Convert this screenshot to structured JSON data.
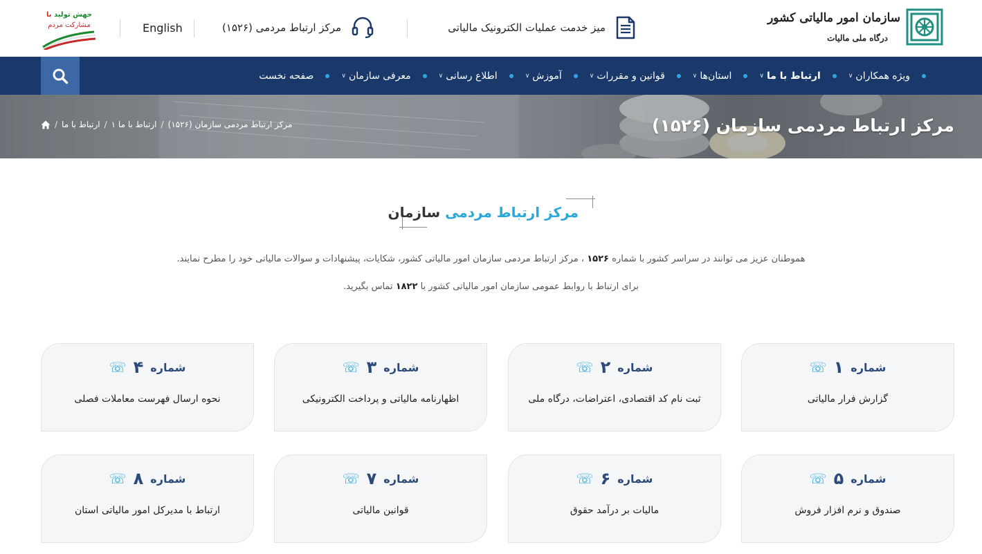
{
  "header": {
    "logo_title": "سازمان امور مالیاتی کشور",
    "logo_subtitle": "درگاه ملی مالیات",
    "service_desk_label": "میز خدمت عملیات الکترونیک مالیاتی",
    "contact_center_label": "مرکز ارتباط مردمی (۱۵۲۶)",
    "language_label": "English",
    "slogan_line1_green": "جهش تولید",
    "slogan_line1_red": "با",
    "slogan_line2": "مشارکت مردم"
  },
  "nav": {
    "items": [
      {
        "label": "صفحه نخست",
        "has_dropdown": false,
        "active": false
      },
      {
        "label": "معرفی سازمان",
        "has_dropdown": true,
        "active": false
      },
      {
        "label": "اطلاع رسانی",
        "has_dropdown": true,
        "active": false
      },
      {
        "label": "آموزش",
        "has_dropdown": true,
        "active": false
      },
      {
        "label": "قوانین و مقررات",
        "has_dropdown": true,
        "active": false
      },
      {
        "label": "استان‌ها",
        "has_dropdown": true,
        "active": false
      },
      {
        "label": "ارتباط با ما",
        "has_dropdown": true,
        "active": true
      },
      {
        "label": "ویژه همکاران",
        "has_dropdown": true,
        "active": false
      }
    ],
    "search_icon": "search-icon"
  },
  "banner": {
    "title": "مرکز ارتباط مردمی سازمان (۱۵۲۶)",
    "breadcrumb": [
      "ارتباط با ما",
      "ارتباط با ما ۱",
      "مرکز ارتباط مردمی سازمان (۱۵۲۶)"
    ]
  },
  "section": {
    "title_highlight": "مرکز ارتباط مردمی",
    "title_rest": "سازمان",
    "intro1_pre": "هموطنان عزیز می توانند در سراسر کشور با شماره",
    "intro1_num": "۱۵۲۶",
    "intro1_post": "، مرکز ارتباط مردمی سازمان امور مالیاتی کشور، شکایات، پیشنهادات و سوالات مالیاتی خود را مطرح نمایند.",
    "intro2_pre": "برای ارتباط با روابط عمومی سازمان امور مالیاتی کشور با",
    "intro2_num": "۱۸۲۲",
    "intro2_post": "تماس بگیرید."
  },
  "cards": [
    {
      "label": "شماره",
      "number": "۱",
      "description": "گزارش فرار مالیاتی"
    },
    {
      "label": "شماره",
      "number": "۲",
      "description": "ثبت نام کد اقتصادی، اعتراضات، درگاه ملی"
    },
    {
      "label": "شماره",
      "number": "۳",
      "description": "اظهارنامه مالیاتی و پرداخت الکترونیکی"
    },
    {
      "label": "شماره",
      "number": "۴",
      "description": "نحوه ارسال فهرست معاملات فصلی"
    },
    {
      "label": "شماره",
      "number": "۵",
      "description": "صندوق و نرم افزار فروش"
    },
    {
      "label": "شماره",
      "number": "۶",
      "description": "مالیات بر درآمد حقوق"
    },
    {
      "label": "شماره",
      "number": "۷",
      "description": "قوانین مالیاتی"
    },
    {
      "label": "شماره",
      "number": "۸",
      "description": "ارتباط با مدیرکل امور مالیاتی استان"
    }
  ],
  "colors": {
    "nav_bg": "#1a3869",
    "accent": "#2aa7d9",
    "search_bg": "#3c68a6"
  }
}
